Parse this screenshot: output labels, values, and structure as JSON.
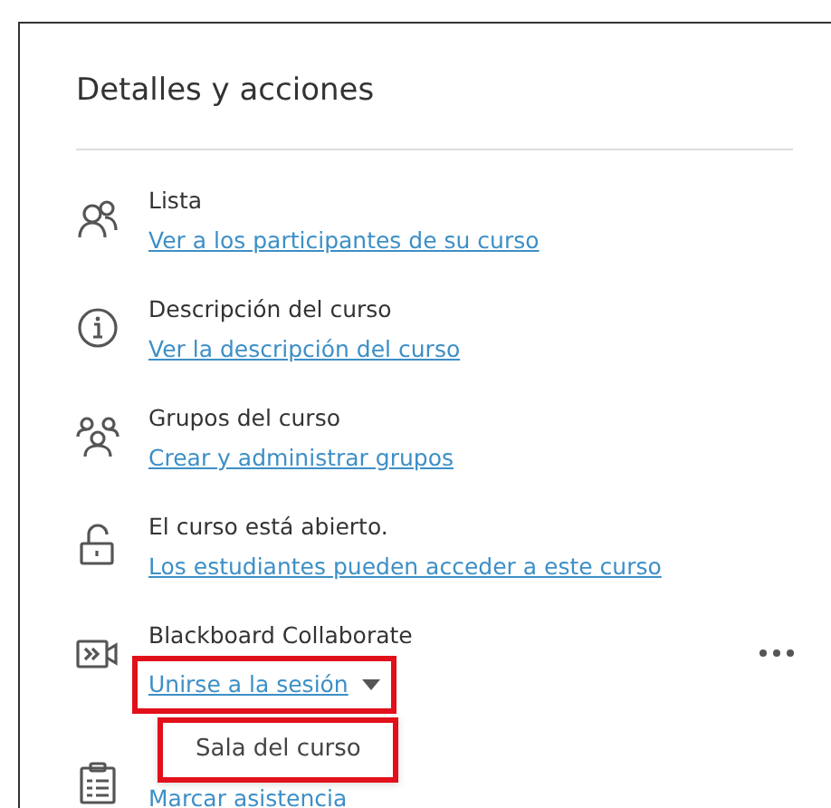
{
  "panel": {
    "title": "Detalles y acciones",
    "items": [
      {
        "kind": "link",
        "title": "Lista",
        "link": "Ver a los participantes de su curso"
      },
      {
        "kind": "link",
        "title": "Descripción del curso",
        "link": "Ver la descripción del curso"
      },
      {
        "kind": "link",
        "title": "Grupos del curso",
        "link": "Crear y administrar grupos"
      },
      {
        "kind": "link",
        "title": "El curso está abierto.",
        "link": "Los estudiantes pueden acceder a este curso"
      },
      {
        "kind": "dropdown",
        "title": "Blackboard Collaborate",
        "link": "Unirse a la sesión",
        "highlighted": true,
        "expanded": true,
        "menu": [
          {
            "label": "Sala del curso",
            "highlighted": true
          }
        ]
      },
      {
        "kind": "link",
        "link": "Marcar asistencia"
      }
    ]
  }
}
